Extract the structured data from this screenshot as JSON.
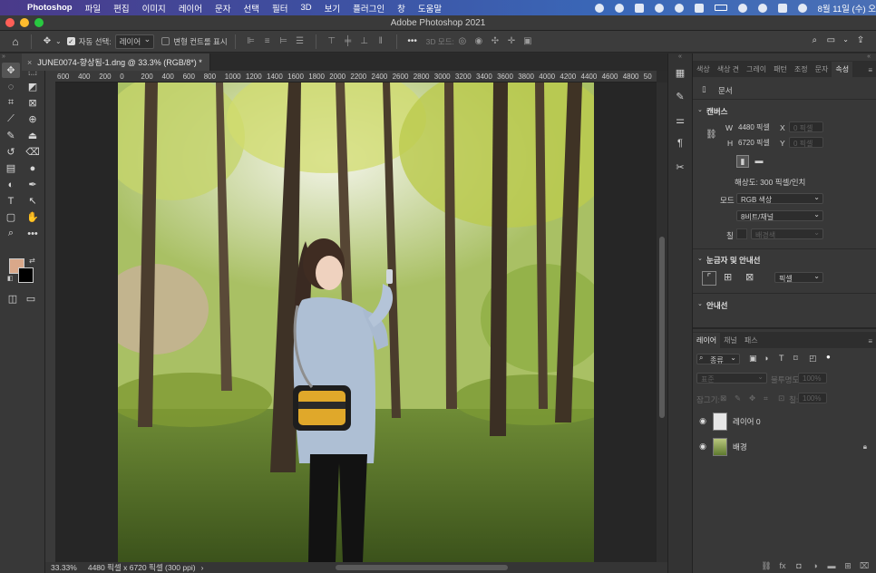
{
  "menubar": {
    "app_name": "Photoshop",
    "items": [
      "파일",
      "편집",
      "이미지",
      "레이어",
      "문자",
      "선택",
      "필터",
      "3D",
      "보기",
      "플러그인",
      "창",
      "도움말"
    ],
    "clock": "8월 11일 (수) 오"
  },
  "window": {
    "title": "Adobe Photoshop 2021"
  },
  "options": {
    "auto_select_label": "자동 선택:",
    "auto_select_value": "레이어",
    "transform_label": "변형 컨트롤 표시",
    "mode_3d_label": "3D 모드:"
  },
  "document": {
    "tab_title": "JUNE0074-향상됨-1.dng @ 33.3% (RGB/8*) *",
    "zoom": "33.33%",
    "doc_info": "4480 픽셀 x 6720 픽셀 (300 ppi)"
  },
  "ruler": {
    "ticks": [
      "600",
      "400",
      "200",
      "0",
      "200",
      "400",
      "600",
      "800",
      "1000",
      "1200",
      "1400",
      "1600",
      "1800",
      "2000",
      "2200",
      "2400",
      "2600",
      "2800",
      "3000",
      "3200",
      "3400",
      "3600",
      "3800",
      "4000",
      "4200",
      "4400",
      "4600",
      "4800",
      "50"
    ]
  },
  "properties": {
    "tabs": [
      "색상",
      "색상 견",
      "그레이",
      "패턴",
      "조정",
      "문자",
      "속성"
    ],
    "doc_label": "문서",
    "canvas_section": "캔버스",
    "w_label": "W",
    "w_value": "4480 픽셀",
    "h_label": "H",
    "h_value": "6720 픽셀",
    "x_label": "X",
    "y_label": "Y",
    "x_placeholder": "0 픽셀",
    "y_placeholder": "0 픽셀",
    "resolution": "해상도: 300 픽셀/인치",
    "mode_label": "모드",
    "mode_value": "RGB 색상",
    "depth_value": "8비트/채널",
    "fill_label": "칠",
    "fill_value": "배경색",
    "rulers_section": "눈금자 및 안내선",
    "rulers_unit": "픽셀",
    "guides_section": "안내선"
  },
  "layers": {
    "tabs": [
      "레이어",
      "채널",
      "패스"
    ],
    "filter_value": "종류",
    "blend_value": "표준",
    "opacity_label": "불투명도:",
    "opacity_value": "100%",
    "lock_label": "잠그기:",
    "fill_label": "칠:",
    "fill_value": "100%",
    "items": [
      {
        "name": "레이어 0"
      },
      {
        "name": "배경"
      }
    ]
  }
}
